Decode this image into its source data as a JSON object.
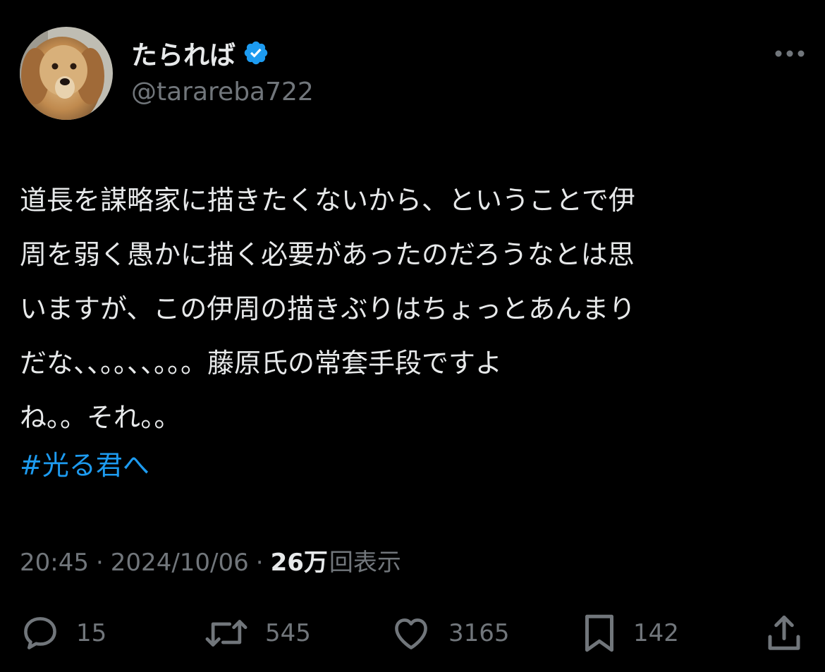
{
  "author": {
    "display_name": "たられば",
    "handle": "@tarareba722",
    "verified": true,
    "avatar_icon": "dog-avatar"
  },
  "tweet": {
    "lines": [
      "道長を謀略家に描きたくないから、ということで伊",
      "周を弱く愚かに描く必要があったのだろうなとは思",
      "いますが、この伊周の描きぶりはちょっとあんまり",
      "だな、、。。、、。。。藤原氏の常套手段ですよ",
      "ね。。それ。。"
    ],
    "hashtag": "#光る君へ"
  },
  "meta": {
    "time": "20:45",
    "separator": "·",
    "date": "2024/10/06",
    "views_count": "26万",
    "views_label": "回表示"
  },
  "actions": {
    "replies": "15",
    "retweets": "545",
    "likes": "3165",
    "bookmarks": "142"
  },
  "colors": {
    "background": "#000000",
    "text": "#e7e9ea",
    "secondary": "#71767b",
    "accent": "#1d9bf0"
  }
}
